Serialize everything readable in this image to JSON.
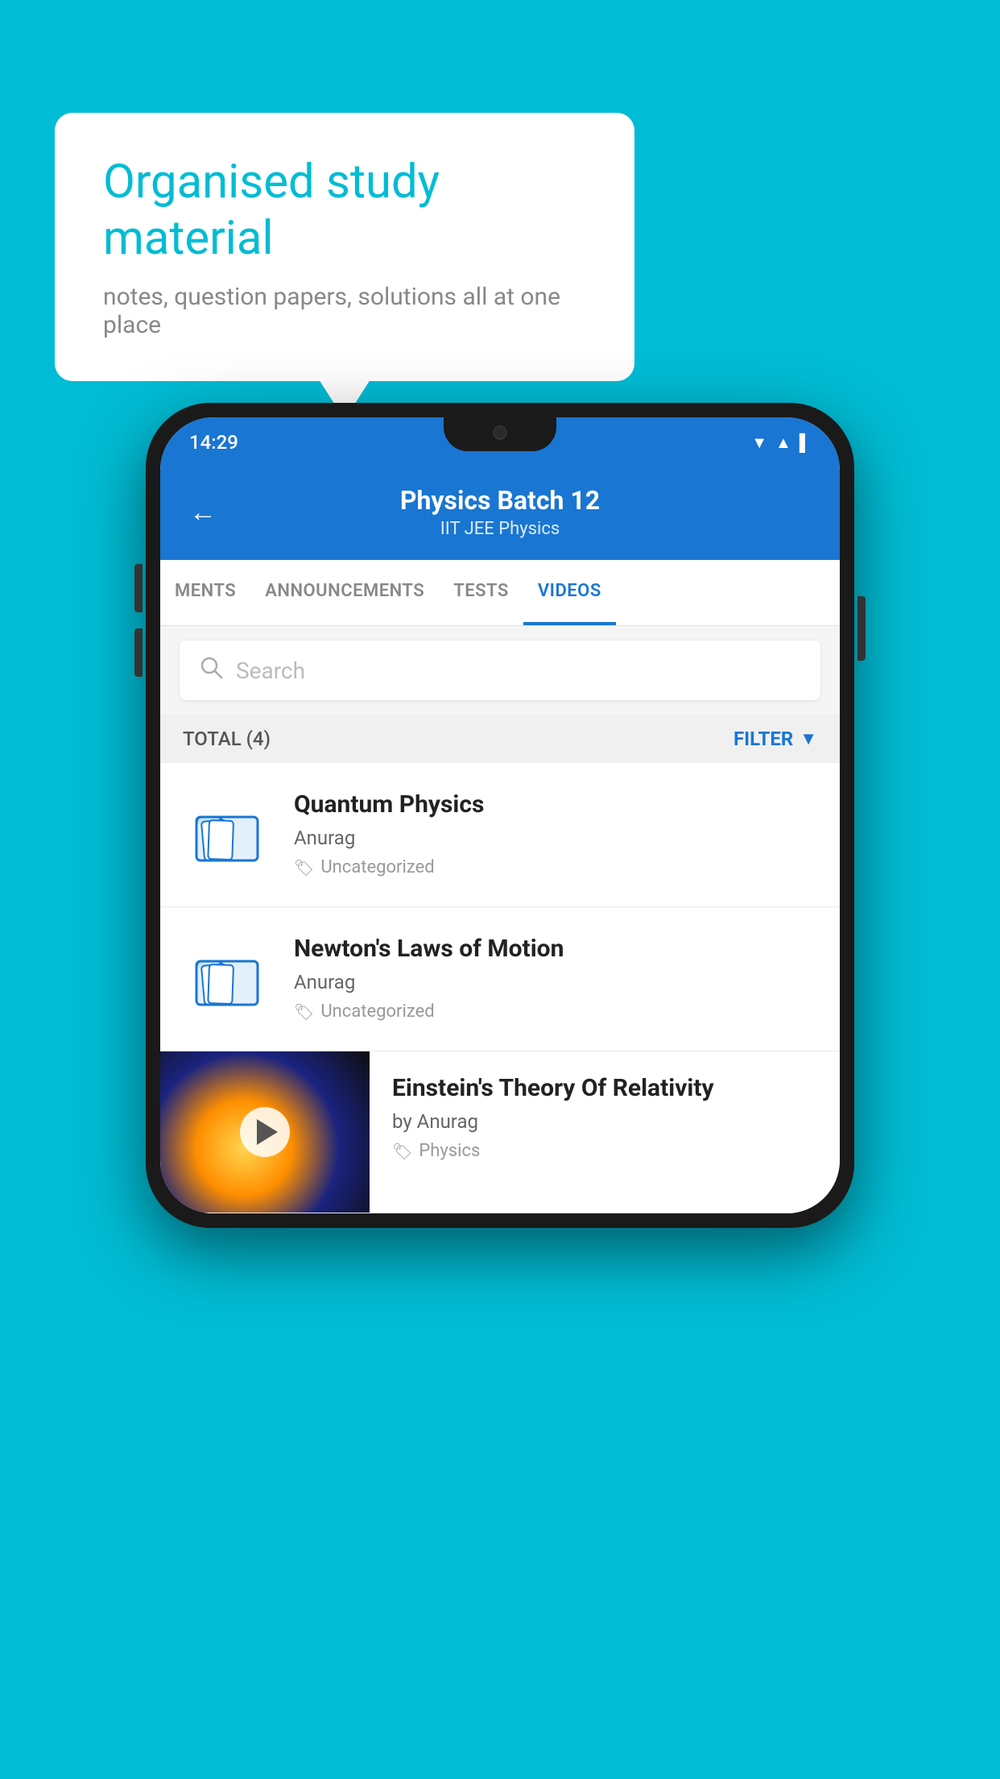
{
  "background": {
    "color": "#00bcd4"
  },
  "bubble": {
    "title": "Organised study material",
    "subtitle": "notes, question papers, solutions all at one place"
  },
  "phone": {
    "statusBar": {
      "time": "14:29",
      "icons": "▼▲▌"
    },
    "header": {
      "title": "Physics Batch 12",
      "subtitle": "IIT JEE   Physics",
      "backLabel": "←"
    },
    "tabs": [
      {
        "label": "MENTS",
        "active": false
      },
      {
        "label": "ANNOUNCEMENTS",
        "active": false
      },
      {
        "label": "TESTS",
        "active": false
      },
      {
        "label": "VIDEOS",
        "active": true
      }
    ],
    "search": {
      "placeholder": "Search"
    },
    "filterRow": {
      "total": "TOTAL (4)",
      "filterLabel": "FILTER"
    },
    "videos": [
      {
        "title": "Quantum Physics",
        "author": "Anurag",
        "tag": "Uncategorized",
        "type": "folder"
      },
      {
        "title": "Newton's Laws of Motion",
        "author": "Anurag",
        "tag": "Uncategorized",
        "type": "folder"
      },
      {
        "title": "Einstein's Theory Of Relativity",
        "author": "by Anurag",
        "tag": "Physics",
        "type": "thumbnail"
      }
    ]
  }
}
